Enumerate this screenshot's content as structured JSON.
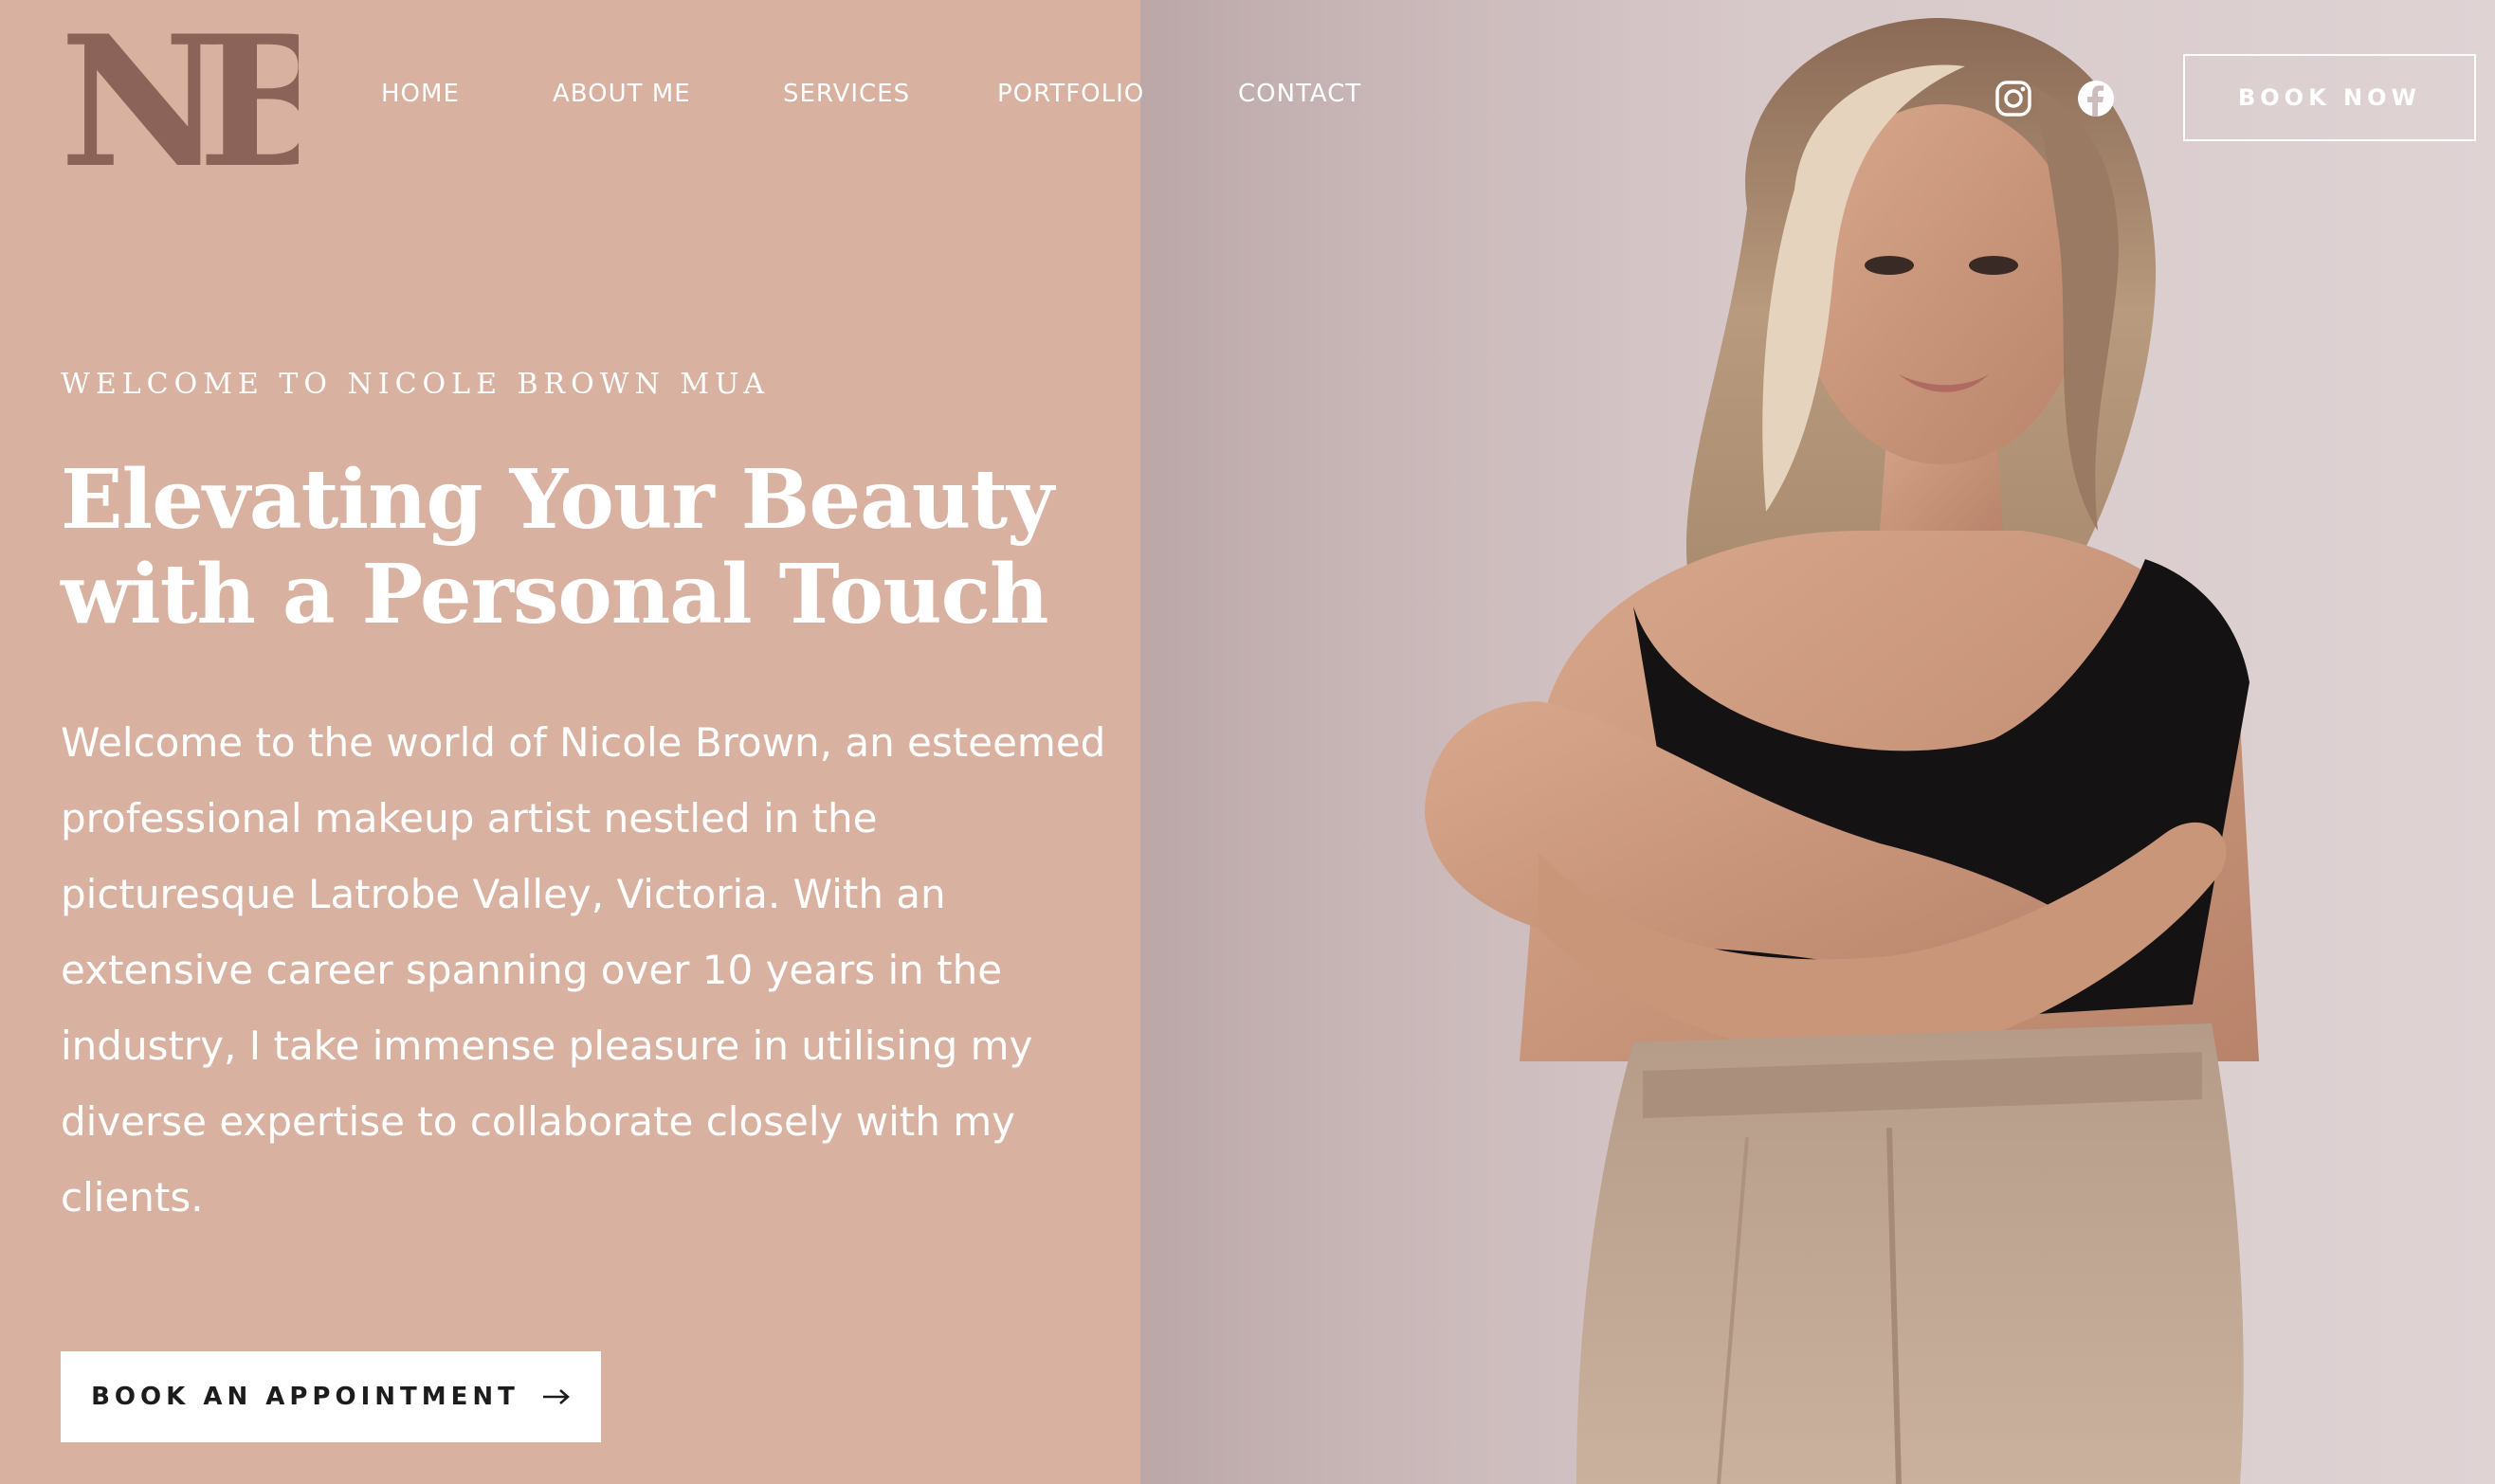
{
  "brand": {
    "logo_text": "NB",
    "logo_color": "#8c6358"
  },
  "nav": {
    "items": [
      {
        "label": "HOME"
      },
      {
        "label": "ABOUT ME"
      },
      {
        "label": "SERVICES"
      },
      {
        "label": "PORTFOLIO"
      },
      {
        "label": "CONTACT"
      }
    ]
  },
  "header": {
    "social_icons": [
      "instagram-icon",
      "facebook-icon"
    ],
    "book_now_label": "BOOK NOW"
  },
  "hero": {
    "eyebrow": "WELCOME TO NICOLE BROWN MUA",
    "headline": "Elevating Your Beauty with a Personal Touch",
    "intro": "Welcome to the world of Nicole Brown, an esteemed professional makeup artist nestled in the picturesque Latrobe Valley, Victoria. With an extensive career spanning over 10 years in the industry, I take immense pleasure in utilising my diverse expertise to collaborate closely with my clients.",
    "cta_label": "BOOK AN APPOINTMENT",
    "cta_icon": "arrow-right-icon"
  },
  "colors": {
    "left_panel": "#d8b1a0",
    "text": "#ffffff",
    "cta_bg": "#ffffff",
    "cta_text": "#1c1c1c"
  }
}
